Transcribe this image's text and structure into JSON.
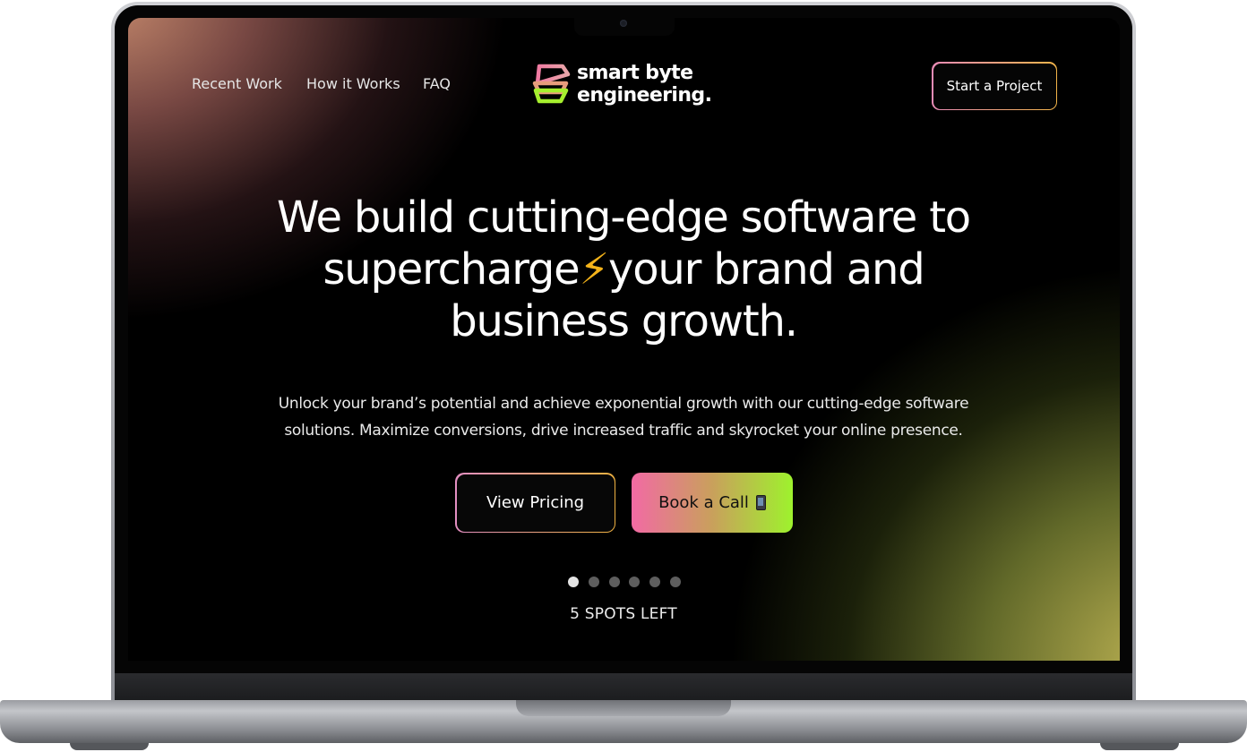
{
  "nav": {
    "links": [
      {
        "label": "Recent Work"
      },
      {
        "label": "How it Works"
      },
      {
        "label": "FAQ"
      }
    ],
    "cta_label": "Start a Project"
  },
  "logo": {
    "line1": "smart byte",
    "line2": "engineering."
  },
  "hero": {
    "headline_line1": "We build cutting-edge software to",
    "headline_line2_a": "supercharge",
    "headline_bolt": "⚡",
    "headline_line2_b": "your brand and",
    "headline_line3": "business growth.",
    "subtext_line1": "Unlock your brand’s potential and achieve exponential growth with our cutting-edge software",
    "subtext_line2": "solutions. Maximize conversions, drive increased traffic and skyrocket your online presence.",
    "primary_button": "View Pricing",
    "secondary_button": "Book a Call",
    "secondary_icon": "phone-icon"
  },
  "availability": {
    "dots_total": 6,
    "dots_filled": 1,
    "label": "5 SPOTS LEFT"
  },
  "colors": {
    "background": "#000000",
    "text": "#ffffff",
    "accent_pink": "#f26aa4",
    "accent_green": "#9ef22d",
    "accent_orange": "#f0b241",
    "logo_pink": "#ee6fa3",
    "logo_green": "#a6ef2e"
  }
}
